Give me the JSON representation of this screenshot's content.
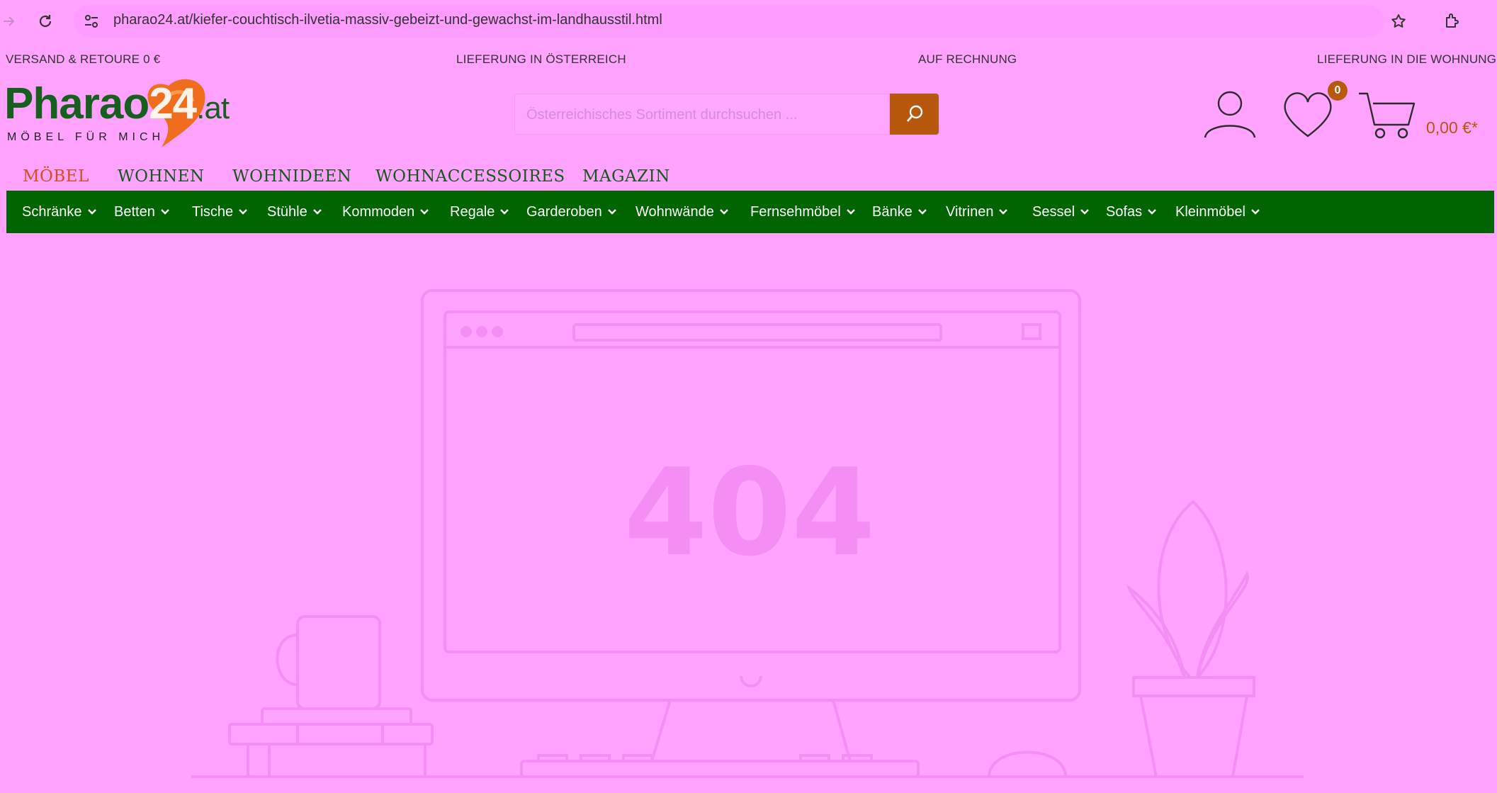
{
  "browser": {
    "url": "pharao24.at/kiefer-couchtisch-ilvetia-massiv-gebeizt-und-gewachst-im-landhausstil.html"
  },
  "topbar": {
    "items": [
      "VERSAND & RETOURE 0 €",
      "LIEFERUNG IN ÖSTERREICH",
      "AUF RECHNUNG",
      "LIEFERUNG IN DIE WOHNUNG"
    ]
  },
  "logo": {
    "name_main": "Pharao",
    "name_num": "24",
    "name_tld": ".at",
    "tagline": "MÖBEL FÜR MICH"
  },
  "search": {
    "placeholder": "Österreichisches Sortiment durchsuchen ..."
  },
  "header": {
    "wishlist_count": "0",
    "cart_total": "0,00 €*"
  },
  "main_nav": [
    "MÖBEL",
    "WOHNEN",
    "WOHNIDEEN",
    "WOHNACCESSOIRES",
    "MAGAZIN"
  ],
  "categories": [
    "Schränke",
    "Betten",
    "Tische",
    "Stühle",
    "Kommoden",
    "Regale",
    "Garderoben",
    "Wohnwände",
    "Fernsehmöbel",
    "Bänke",
    "Vitrinen",
    "Sessel",
    "Sofas",
    "Kleinmöbel"
  ],
  "error": {
    "code": "404"
  },
  "colors": {
    "background": "#ffa3ff",
    "brand_green": "#006400",
    "accent_orange": "#b8580d",
    "active_nav": "#d4501b"
  }
}
